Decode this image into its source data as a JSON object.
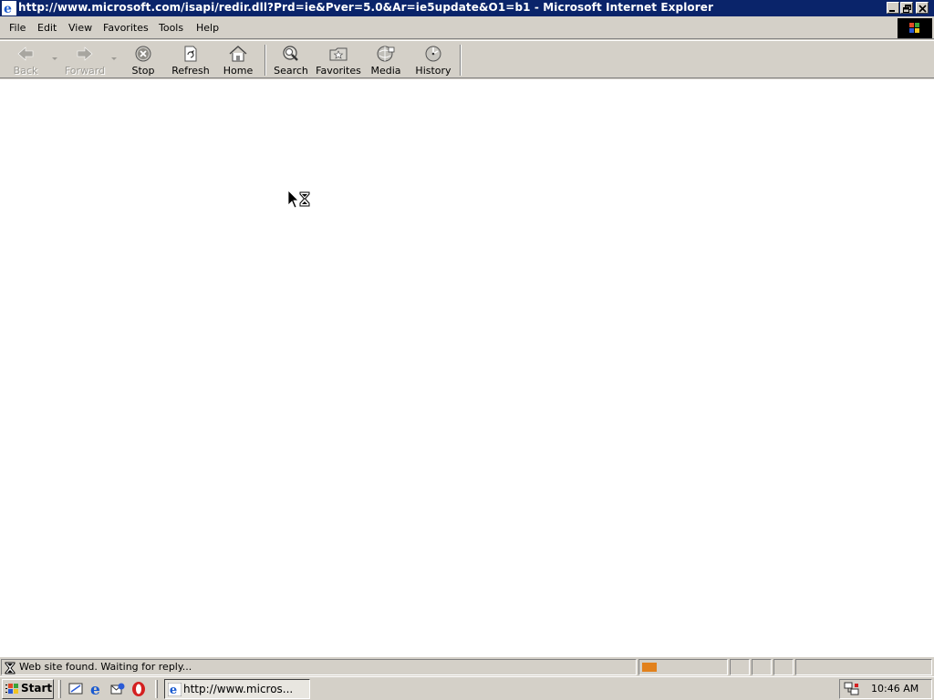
{
  "window": {
    "title": "http://www.microsoft.com/isapi/redir.dll?Prd=ie&Pver=5.0&Ar=ie5update&O1=b1 - Microsoft Internet Explorer",
    "icon": "ie-icon"
  },
  "menubar": {
    "items": [
      {
        "label": "File"
      },
      {
        "label": "Edit"
      },
      {
        "label": "View"
      },
      {
        "label": "Favorites"
      },
      {
        "label": "Tools"
      },
      {
        "label": "Help"
      }
    ]
  },
  "toolbar": {
    "back": {
      "label": "Back",
      "icon": "back-arrow-icon",
      "enabled": false
    },
    "forward": {
      "label": "Forward",
      "icon": "forward-arrow-icon",
      "enabled": false
    },
    "stop": {
      "label": "Stop",
      "icon": "stop-icon"
    },
    "refresh": {
      "label": "Refresh",
      "icon": "refresh-icon"
    },
    "home": {
      "label": "Home",
      "icon": "home-icon"
    },
    "search": {
      "label": "Search",
      "icon": "search-icon"
    },
    "favorites": {
      "label": "Favorites",
      "icon": "favorites-icon"
    },
    "media": {
      "label": "Media",
      "icon": "media-icon"
    },
    "history": {
      "label": "History",
      "icon": "history-icon"
    }
  },
  "statusbar": {
    "text": "Web site found. Waiting for reply...",
    "progress_color": "#e2811c"
  },
  "taskbar": {
    "start_label": "Start",
    "task_label": "http://www.micros...",
    "clock": "10:46 AM"
  },
  "colors": {
    "titlebar": "#0a246a",
    "chrome": "#d4d0c8"
  }
}
